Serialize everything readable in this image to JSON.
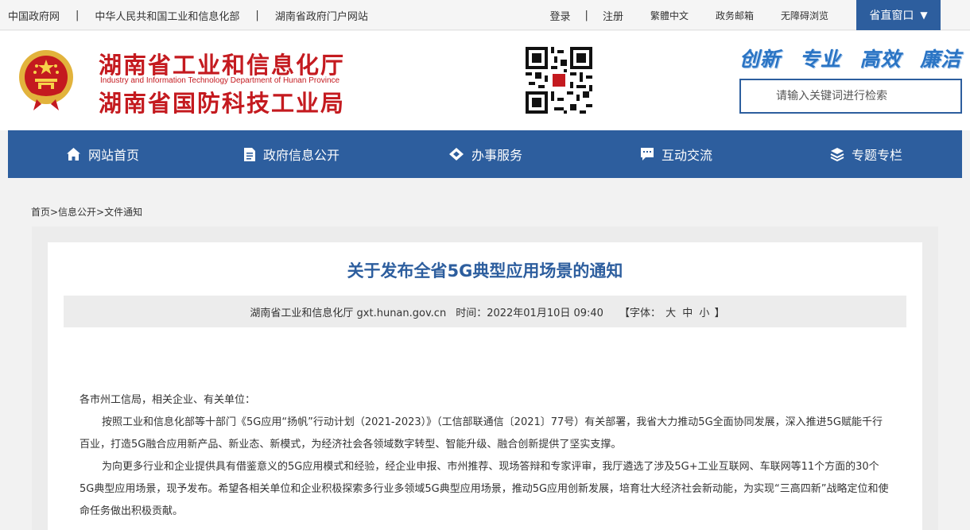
{
  "topbar": {
    "left_links": [
      "中国政府网",
      "中华人民共和国工业和信息化部",
      "湖南省政府门户网站"
    ],
    "separator": "|",
    "login": "登录",
    "register": "注册",
    "traditional": "繁體中文",
    "gov_mail": "政务邮箱",
    "accessible": "无障碍浏览",
    "dropdown_label": "省直窗口",
    "dropdown_caret": "▼"
  },
  "header": {
    "org_name_1": "湖南省工业和信息化厅",
    "org_name_en": "Industry and Information Technology Department of Hunan Province",
    "org_name_2": "湖南省国防科技工业局",
    "slogan": [
      "创新",
      "专业",
      "高效",
      "廉洁"
    ],
    "search_placeholder": "请输入关键词进行检索",
    "emblem_icon": "national-emblem-icon",
    "qr_icon": "qr-code-icon"
  },
  "nav": {
    "items": [
      {
        "label": "网站首页",
        "icon": "home-icon"
      },
      {
        "label": "政府信息公开",
        "icon": "document-icon"
      },
      {
        "label": "办事服务",
        "icon": "handshake-icon"
      },
      {
        "label": "互动交流",
        "icon": "chat-icon"
      },
      {
        "label": "专题专栏",
        "icon": "layers-icon"
      }
    ]
  },
  "breadcrumb": "首页>信息公开>文件通知",
  "article": {
    "title": "关于发布全省5G典型应用场景的通知",
    "source": "湖南省工业和信息化厅 gxt.hunan.gov.cn",
    "time": "时间：2022年01月10日 09:40",
    "font_label": "【字体：",
    "font_large": "大",
    "font_medium": "中",
    "font_small": "小",
    "font_close": "】",
    "salutation": "各市州工信局，相关企业、有关单位：",
    "para1": "按照工业和信息化部等十部门《5G应用“扬帆”行动计划（2021-2023）》（工信部联通信〔2021〕77号）有关部署，我省大力推动5G全面协同发展，深入推进5G赋能千行百业，打造5G融合应用新产品、新业态、新模式，为经济社会各领域数字转型、智能升级、融合创新提供了坚实支撑。",
    "para2": "为向更多行业和企业提供具有借鉴意义的5G应用模式和经验，经企业申报、市州推荐、现场答辩和专家评审，我厅遴选了涉及5G+工业互联网、车联网等11个方面的30个5G典型应用场景，现予发布。希望各相关单位和企业积极探索多行业多领域5G典型应用场景，推动5G应用创新发展，培育壮大经济社会新动能，为实现“三高四新”战略定位和使命任务做出积极贡献。"
  },
  "colors": {
    "primary_blue": "#2d5e9e",
    "org_red": "#c41a1f",
    "slogan_blue": "#2a74c4"
  }
}
